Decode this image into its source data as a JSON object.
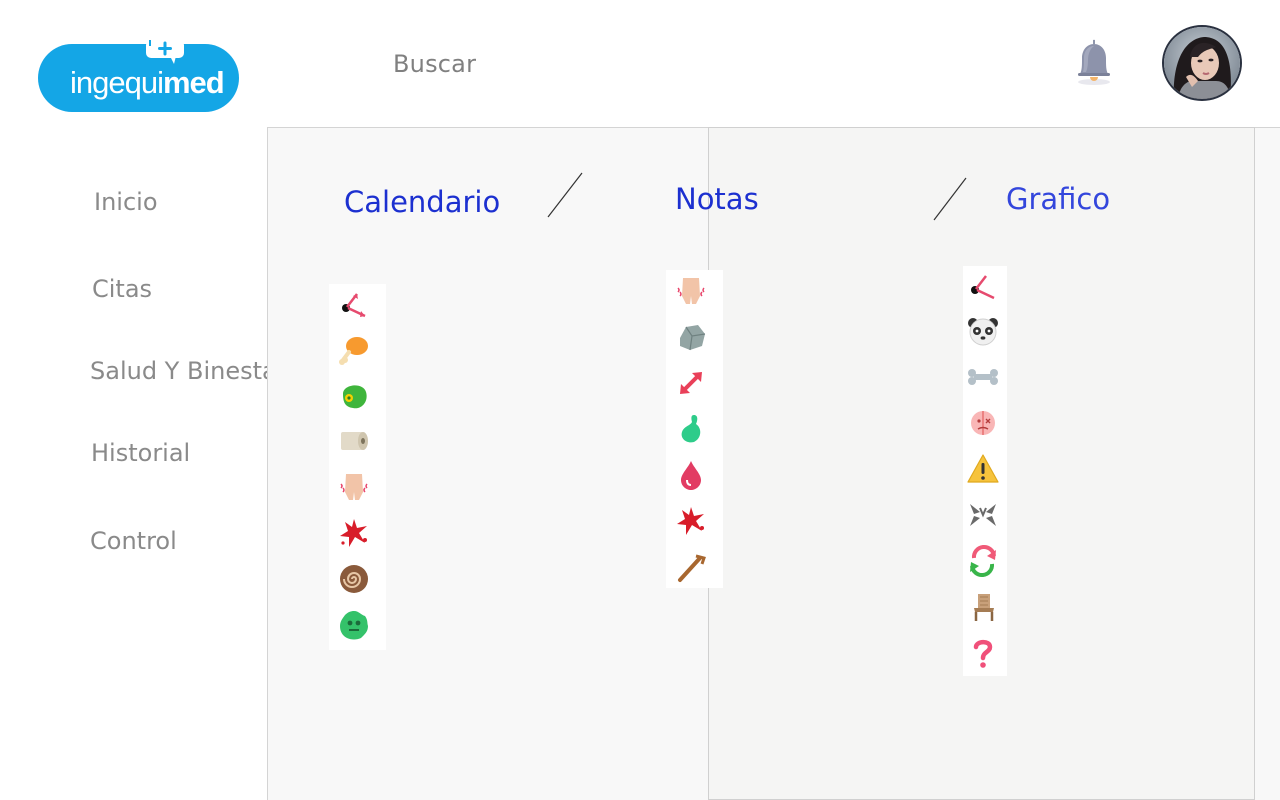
{
  "brand": {
    "logo_light": "ingequi",
    "logo_bold": "med",
    "color": "#14a6e6"
  },
  "header": {
    "search_label": "Buscar"
  },
  "sidebar": {
    "items": [
      {
        "label": "Inicio"
      },
      {
        "label": "Citas"
      },
      {
        "label": "Salud Y Binestar"
      },
      {
        "label": "Historial"
      },
      {
        "label": "Control"
      }
    ]
  },
  "tabs": [
    {
      "label": "Calendario"
    },
    {
      "label": "Notas"
    },
    {
      "label": "Grafico"
    }
  ],
  "colors": {
    "tab_text": "#1c30d0",
    "nav_text": "#8a8a8a"
  },
  "icon_columns": {
    "calendario": [
      "clock-hands-icon",
      "chicken-leg-icon",
      "cell-icon",
      "toilet-paper-icon",
      "body-ache-icon",
      "blood-splat-icon",
      "spiral-icon",
      "virus-icon"
    ],
    "notas": [
      "body-ache-icon",
      "rock-icon",
      "expand-arrows-icon",
      "green-drop-icon",
      "blood-drop-icon",
      "blood-splat-icon",
      "stick-icon"
    ],
    "grafico": [
      "clock-hands-icon",
      "panda-icon",
      "bone-icon",
      "sick-face-icon",
      "warning-icon",
      "broken-icon",
      "refresh-icon",
      "chair-icon",
      "question-icon"
    ]
  }
}
